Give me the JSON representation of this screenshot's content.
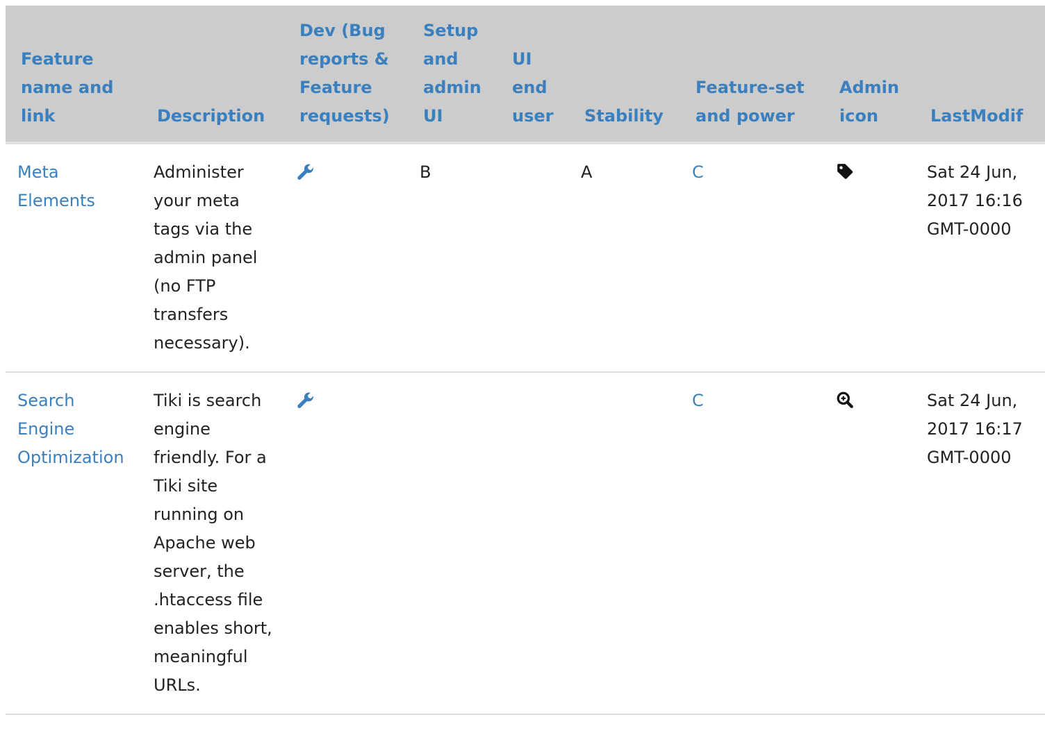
{
  "table": {
    "columns": [
      {
        "label": "Feature name and link"
      },
      {
        "label": "Description"
      },
      {
        "label": "Dev (Bug reports & Feature requests)"
      },
      {
        "label": "Setup and admin UI"
      },
      {
        "label": "UI end user"
      },
      {
        "label": "Stability"
      },
      {
        "label": "Feature-set and power"
      },
      {
        "label": "Admin icon"
      },
      {
        "label": "LastModif"
      }
    ],
    "rows": [
      {
        "feature": "Meta Elements",
        "description": "Administer your meta tags via the admin panel (no FTP transfers necessary).",
        "dev_icon": "wrench-icon",
        "setup": "B",
        "ui_end_user": "",
        "stability": "A",
        "feature_power": "C",
        "admin_icon": "tag-icon",
        "last_modif": "Sat 24 Jun, 2017 16:16 GMT-0000"
      },
      {
        "feature": "Search Engine Optimization",
        "description": "Tiki is search engine friendly. For a Tiki site running on Apache web server, the .htaccess file enables short, meaningful URLs.",
        "dev_icon": "wrench-icon",
        "setup": "",
        "ui_end_user": "",
        "stability": "",
        "feature_power": "C",
        "admin_icon": "search-plus-icon",
        "last_modif": "Sat 24 Jun, 2017 16:17 GMT-0000"
      }
    ]
  },
  "colors": {
    "header_bg": "#cccccc",
    "link": "#3a80bf",
    "text": "#222222"
  }
}
